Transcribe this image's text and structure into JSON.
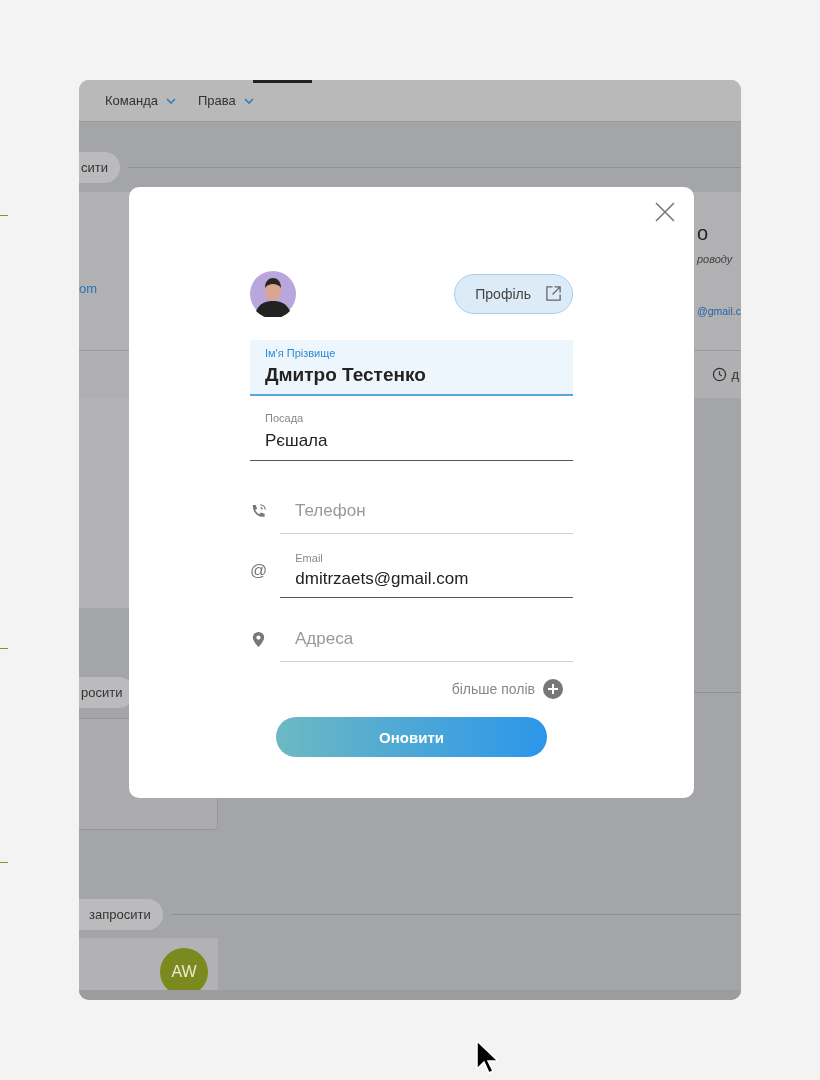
{
  "app_nav": [
    {
      "label": "Команда"
    },
    {
      "label": "Права"
    }
  ],
  "background": {
    "pills": [
      "сити",
      "росити",
      "запросити"
    ],
    "link_fragment": "om",
    "right_card": {
      "title": "о",
      "subtitle": "роводу",
      "email": "@gmail.c"
    },
    "history_fragment": "д",
    "avatar_initials": "AW"
  },
  "modal": {
    "profile_button": "Профіль",
    "fields": [
      {
        "kind": "plain",
        "label": "Ім'я Прізвище",
        "value": "Дмитро Тестенко",
        "focused": true
      },
      {
        "kind": "plain",
        "label": "Посада",
        "value": "Рєшала",
        "focused": false
      },
      {
        "kind": "phone",
        "placeholder": "Телефон",
        "focused": false
      },
      {
        "kind": "email",
        "icon_text": "@",
        "label": "Email",
        "value": "dmitrzaets@gmail.com",
        "focused": false
      },
      {
        "kind": "address",
        "placeholder": "Адреса",
        "focused": false
      }
    ],
    "more_fields": "більше полів",
    "submit": "Оновити"
  }
}
